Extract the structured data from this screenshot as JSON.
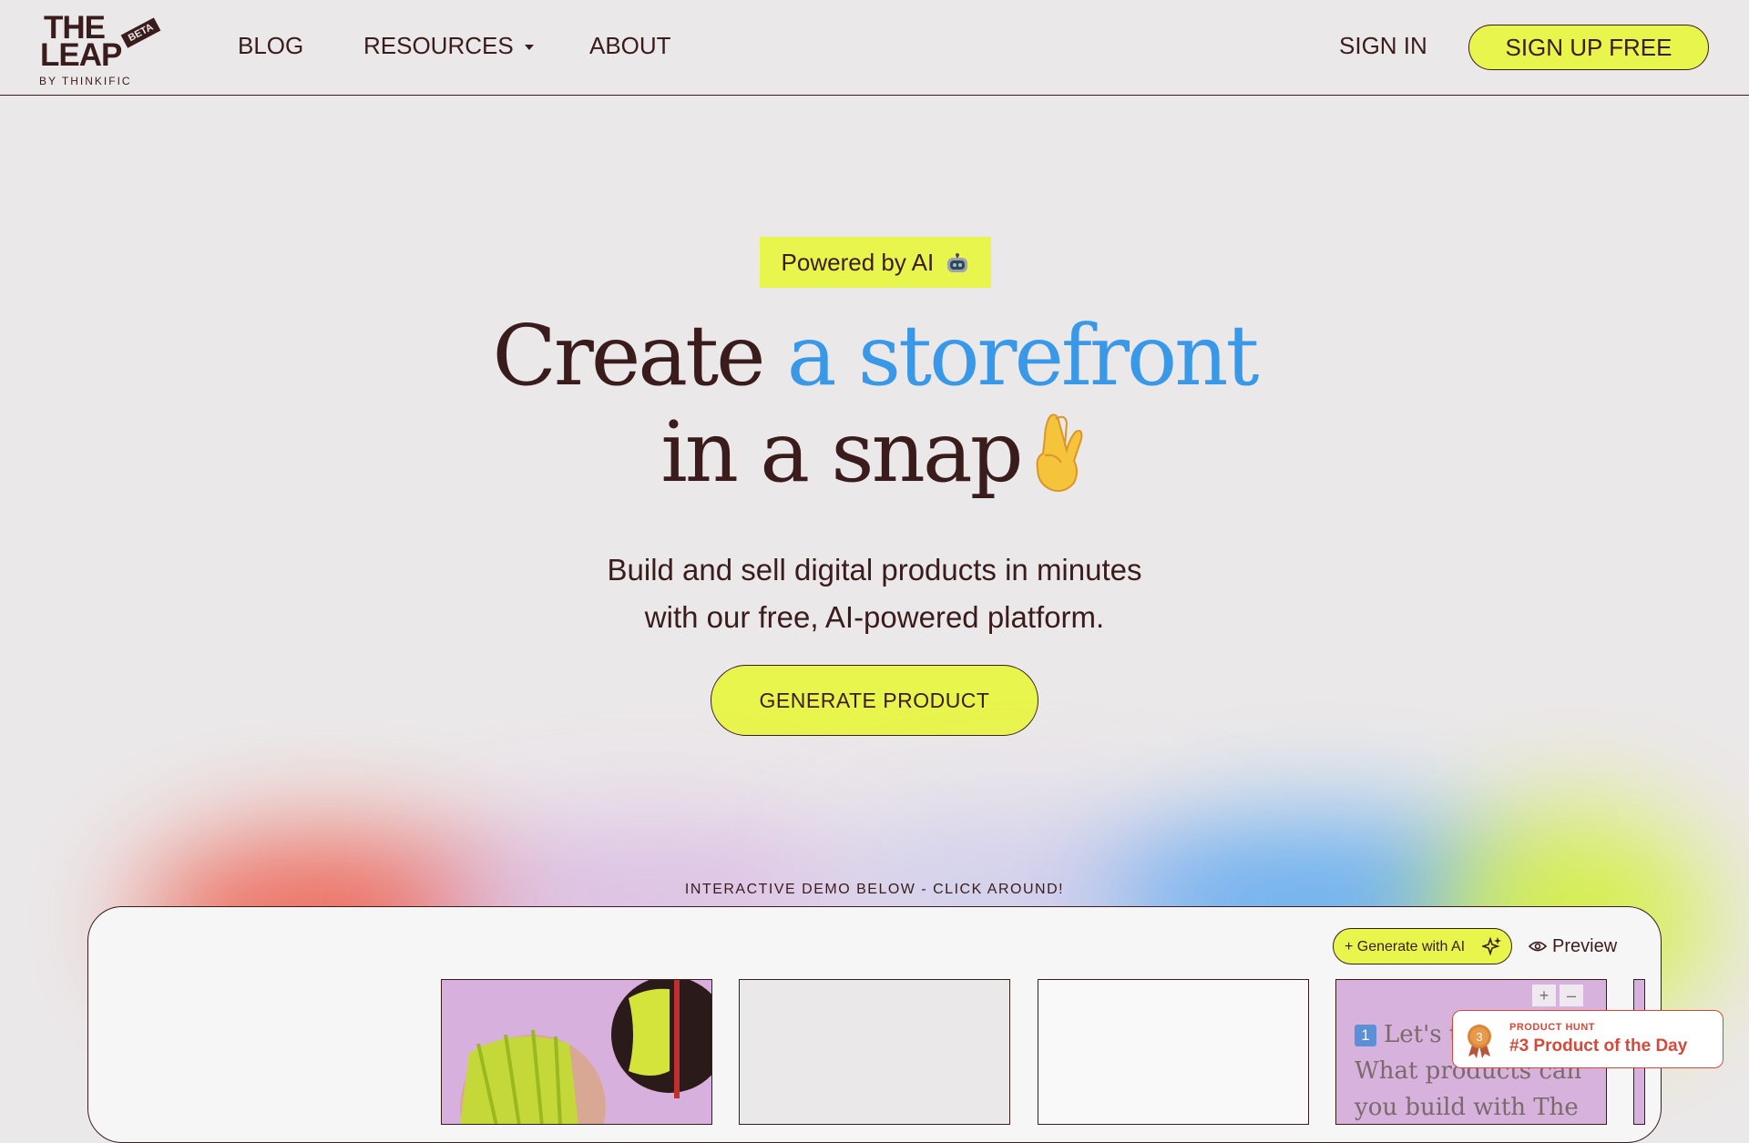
{
  "header": {
    "logo": {
      "line1": "THE",
      "line2": "LEAP",
      "badge": "BETA",
      "byline": "BY THINKIFIC"
    },
    "nav": [
      {
        "label": "BLOG"
      },
      {
        "label": "RESOURCES",
        "has_dropdown": true
      },
      {
        "label": "ABOUT"
      }
    ],
    "sign_in": "SIGN IN",
    "sign_up": "SIGN UP FREE"
  },
  "hero": {
    "badge": "Powered by AI",
    "badge_icon": "robot-icon",
    "headline_part1": "Create ",
    "headline_highlight": "a storefront",
    "headline_line2": "in a snap",
    "headline_icon": "crossed-fingers-icon",
    "subtitle_line1": "Build and sell digital products in minutes",
    "subtitle_line2": "with our free, AI-powered platform.",
    "cta": "GENERATE PRODUCT"
  },
  "demo": {
    "label": "INTERACTIVE DEMO BELOW - CLICK AROUND!",
    "generate_ai": "+ Generate with AI",
    "preview": "Preview",
    "card4_line1": "Let's tr",
    "card4_line2": "What products can",
    "card4_line3": "you build with The",
    "card_controls": {
      "plus": "+",
      "minus": "–"
    }
  },
  "product_hunt": {
    "label": "PRODUCT HUNT",
    "title": "#3 Product of the Day",
    "rank": "3"
  },
  "colors": {
    "accent_yellow": "#e8f54c",
    "text_dark": "#3a1c1c",
    "highlight_blue": "#3a98e8",
    "background": "#ebe8e9",
    "product_hunt_red": "#d44a3a"
  }
}
